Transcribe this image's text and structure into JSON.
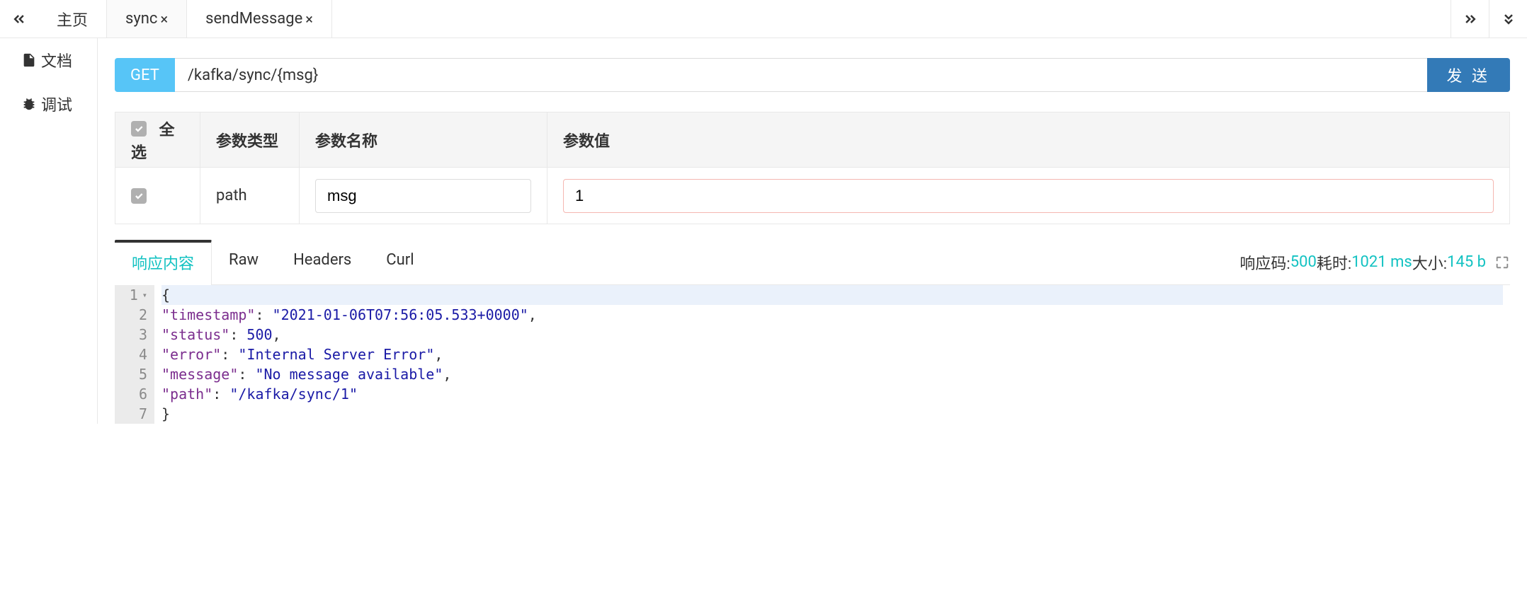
{
  "tabs": {
    "home": "主页",
    "items": [
      {
        "label": "sync",
        "active": true
      },
      {
        "label": "sendMessage",
        "active": false
      }
    ]
  },
  "sidebar": {
    "items": [
      {
        "label": "文档",
        "icon": "document-icon"
      },
      {
        "label": "调试",
        "icon": "bug-icon"
      }
    ]
  },
  "request": {
    "method": "GET",
    "url": "/kafka/sync/{msg}",
    "send_label": "发 送"
  },
  "params_table": {
    "headers": {
      "select_all": "全选",
      "type": "参数类型",
      "name": "参数名称",
      "value": "参数值"
    },
    "rows": [
      {
        "checked": true,
        "type": "path",
        "name": "msg",
        "value": "1"
      }
    ]
  },
  "response": {
    "tabs": [
      {
        "label": "响应内容",
        "active": true
      },
      {
        "label": "Raw",
        "active": false
      },
      {
        "label": "Headers",
        "active": false
      },
      {
        "label": "Curl",
        "active": false
      }
    ],
    "meta": {
      "code_label": "响应码:",
      "code_value": "500",
      "time_label": "耗时:",
      "time_value": "1021 ms",
      "size_label": "大小:",
      "size_value": "145 b"
    },
    "body": {
      "timestamp": "2021-01-06T07:56:05.533+0000",
      "status": 500,
      "error": "Internal Server Error",
      "message": "No message available",
      "path": "/kafka/sync/1"
    },
    "lines": [
      "1",
      "2",
      "3",
      "4",
      "5",
      "6",
      "7"
    ]
  }
}
